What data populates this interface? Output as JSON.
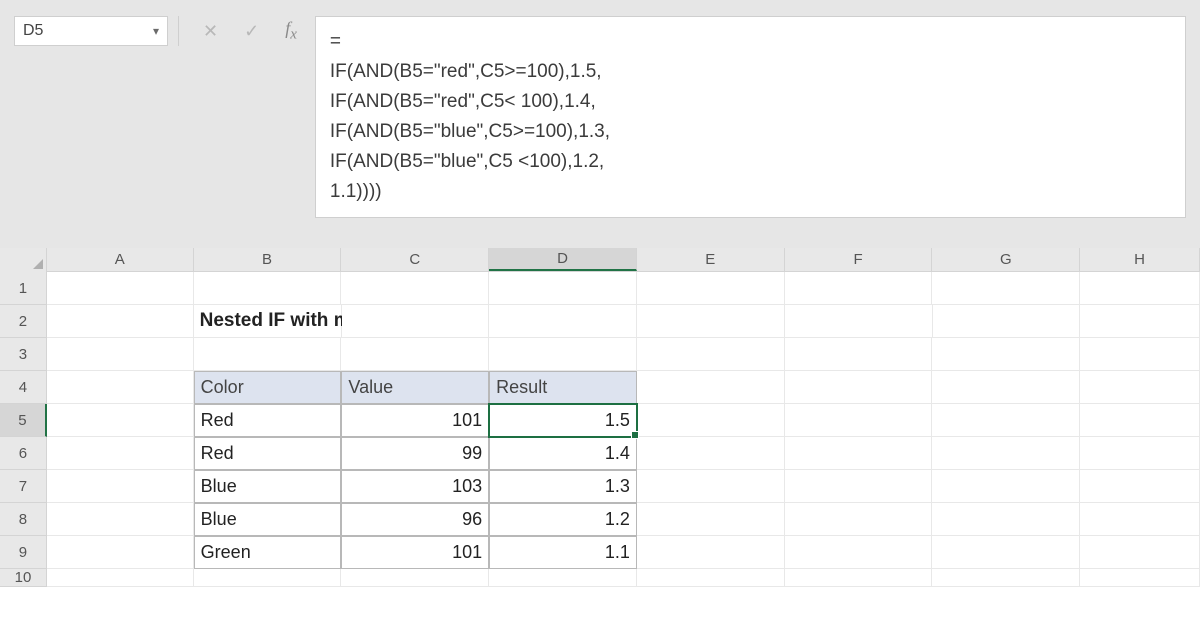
{
  "formula_bar": {
    "cell_ref": "D5",
    "formula": "=\nIF(AND(B5=\"red\",C5>=100),1.5,\nIF(AND(B5=\"red\",C5< 100),1.4,\nIF(AND(B5=\"blue\",C5>=100),1.3,\nIF(AND(B5=\"blue\",C5 <100),1.2,\n1.1))))"
  },
  "columns": [
    "A",
    "B",
    "C",
    "D",
    "E",
    "F",
    "G",
    "H"
  ],
  "row_numbers": [
    "1",
    "2",
    "3",
    "4",
    "5",
    "6",
    "7",
    "8",
    "9",
    "10"
  ],
  "active_col": "D",
  "active_row": "5",
  "sheet": {
    "title": "Nested IF with multiple AND",
    "headers": {
      "color": "Color",
      "value": "Value",
      "result": "Result"
    },
    "rows": [
      {
        "color": "Red",
        "value": "101",
        "result": "1.5"
      },
      {
        "color": "Red",
        "value": "99",
        "result": "1.4"
      },
      {
        "color": "Blue",
        "value": "103",
        "result": "1.3"
      },
      {
        "color": "Blue",
        "value": "96",
        "result": "1.2"
      },
      {
        "color": "Green",
        "value": "101",
        "result": "1.1"
      }
    ]
  }
}
